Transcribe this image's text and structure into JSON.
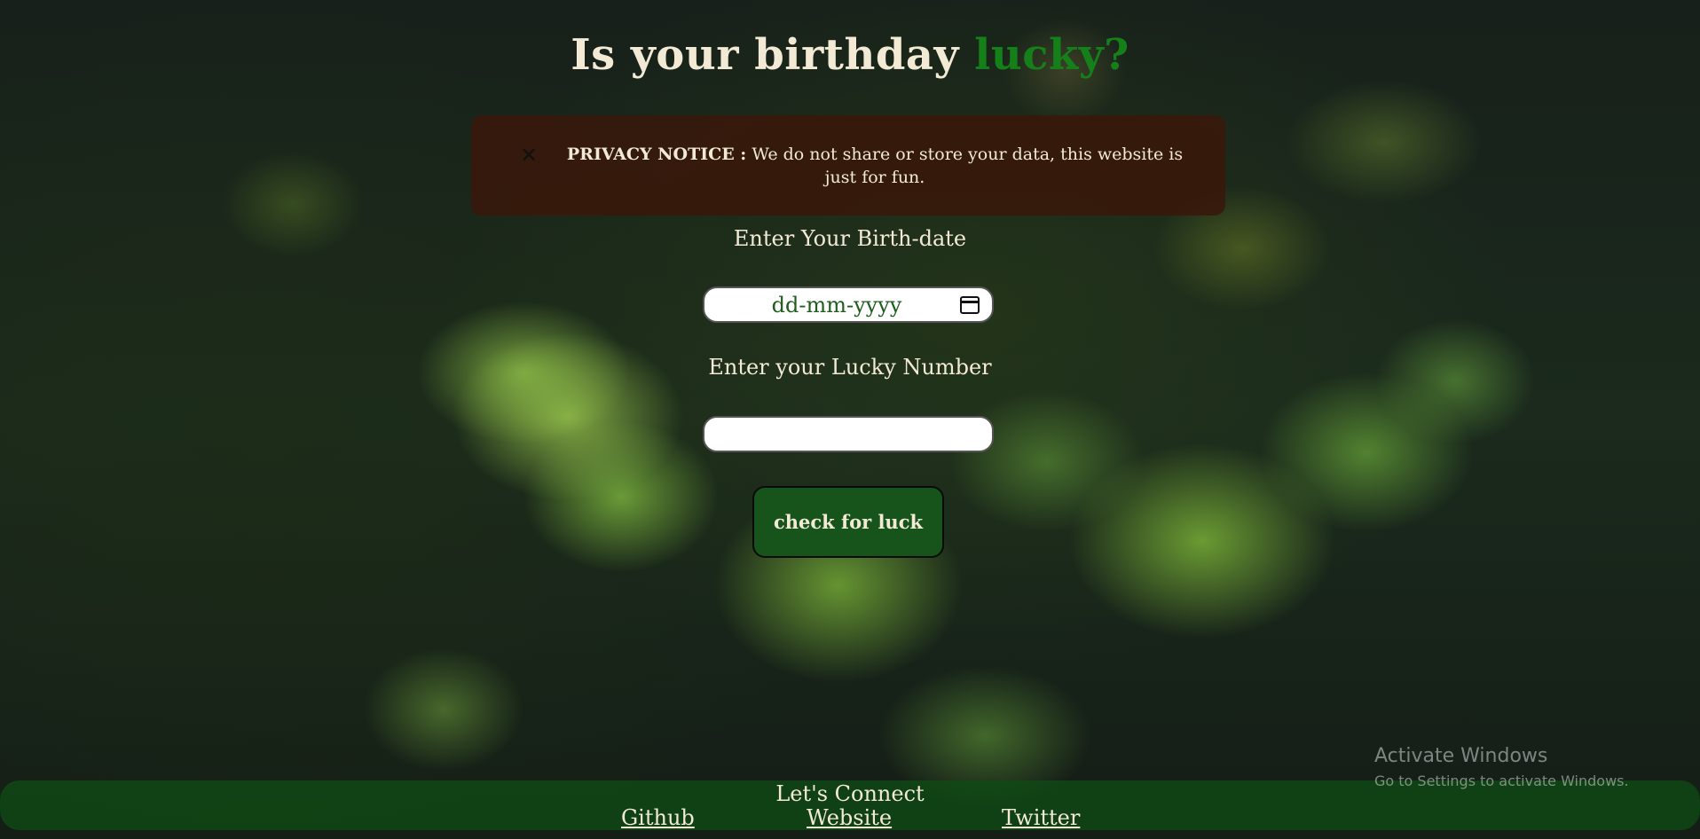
{
  "header": {
    "title_main": "Is your birthday ",
    "title_accent": "lucky?"
  },
  "privacy_notice": {
    "close_icon": "close-icon",
    "heading": "PRIVACY NOTICE :",
    "body": " We do not share or store your data, this website is just for fun."
  },
  "form": {
    "birthdate_label": "Enter Your Birth-date",
    "birthdate_placeholder": "dd-mm-yyyy",
    "birthdate_icon": "calendar-icon",
    "lucky_number_label": "Enter your Lucky Number",
    "lucky_number_value": "",
    "submit_label": "check for luck"
  },
  "footer": {
    "title": "Let's Connect",
    "links": [
      {
        "label": "Github"
      },
      {
        "label": "Website"
      },
      {
        "label": "Twitter"
      }
    ]
  },
  "os_watermark": {
    "line1": "Activate Windows",
    "line2": "Go to Settings to activate Windows."
  },
  "colors": {
    "accent": "#15801a",
    "notice_bg": "#3a180a",
    "button_bg": "#17541c",
    "footer_bg": "#0f4b14",
    "text": "#f3ead6"
  }
}
